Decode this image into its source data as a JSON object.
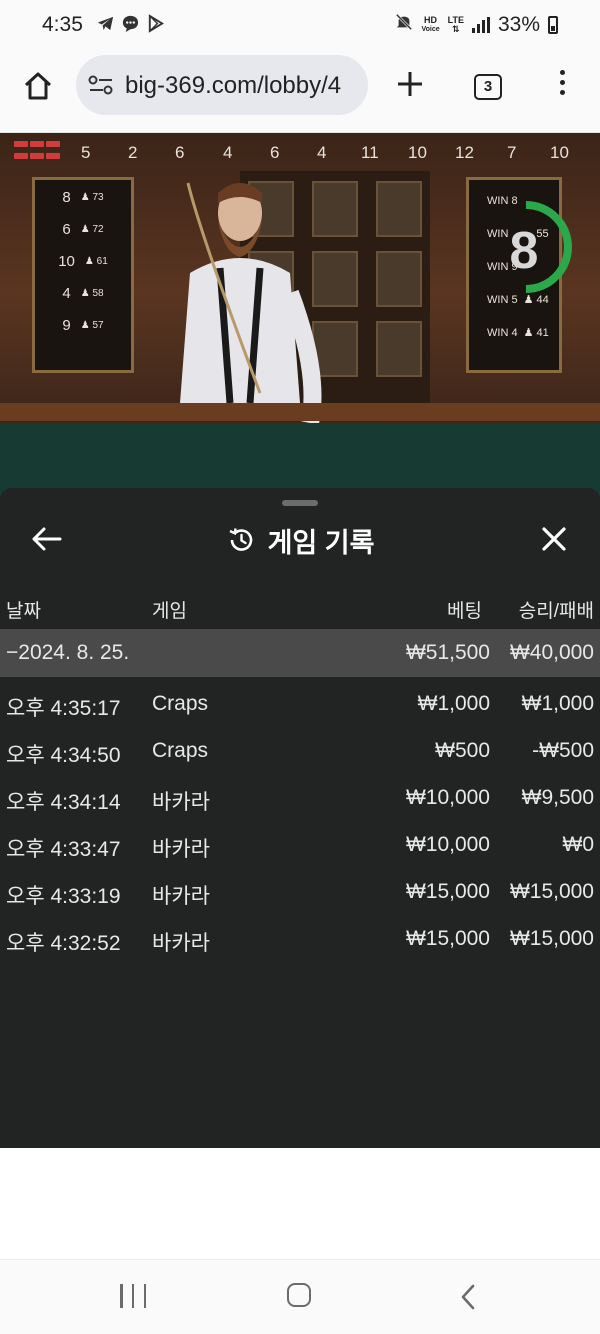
{
  "status_bar": {
    "time": "4:35",
    "battery": "33%",
    "icons": [
      "telegram-icon",
      "chat-icon",
      "play-store-icon",
      "mute-icon",
      "hd-voice-icon",
      "lte-icon",
      "signal-icon",
      "battery-icon"
    ],
    "hd_label": "HD",
    "voice_label": "Voice",
    "lte_label": "LTE"
  },
  "browser": {
    "url": "big-369.com/lobby/4",
    "tab_count": "3"
  },
  "roadmap": [
    "5",
    "2",
    "6",
    "4",
    "6",
    "4",
    "11",
    "10",
    "12",
    "7",
    "10"
  ],
  "hot_numbers": [
    {
      "number": "8",
      "count": "73"
    },
    {
      "number": "6",
      "count": "72"
    },
    {
      "number": "10",
      "count": "61"
    },
    {
      "number": "4",
      "count": "58"
    },
    {
      "number": "9",
      "count": "57"
    }
  ],
  "popular_bets": [
    {
      "label": "WIN 8",
      "count": ""
    },
    {
      "label": "WIN",
      "count": "55"
    },
    {
      "label": "WIN 9",
      "count": ""
    },
    {
      "label": "WIN 5",
      "count": "44"
    },
    {
      "label": "WIN 4",
      "count": "41"
    }
  ],
  "timer": "8",
  "history": {
    "title": "게임 기록",
    "columns": {
      "date": "날짜",
      "game": "게임",
      "bet": "베팅",
      "result": "승리/패배"
    },
    "group": {
      "date": "−2024. 8. 25.",
      "bet": "₩51,500",
      "result": "₩40,000"
    },
    "rows": [
      {
        "time": "오후 4:35:17",
        "game": "Craps",
        "bet": "₩1,000",
        "result": "₩1,000"
      },
      {
        "time": "오후 4:34:50",
        "game": "Craps",
        "bet": "₩500",
        "result": "-₩500"
      },
      {
        "time": "오후 4:34:14",
        "game": "바카라",
        "bet": "₩10,000",
        "result": "₩9,500"
      },
      {
        "time": "오후 4:33:47",
        "game": "바카라",
        "bet": "₩10,000",
        "result": "₩0"
      },
      {
        "time": "오후 4:33:19",
        "game": "바카라",
        "bet": "₩15,000",
        "result": "₩15,000"
      },
      {
        "time": "오후 4:32:52",
        "game": "바카라",
        "bet": "₩15,000",
        "result": "₩15,000"
      }
    ]
  },
  "colors": {
    "timer_ring": "#2aa84a",
    "sheet_bg": "#222222",
    "group_row_bg": "#4a4a4a",
    "felt": "#173a32"
  }
}
